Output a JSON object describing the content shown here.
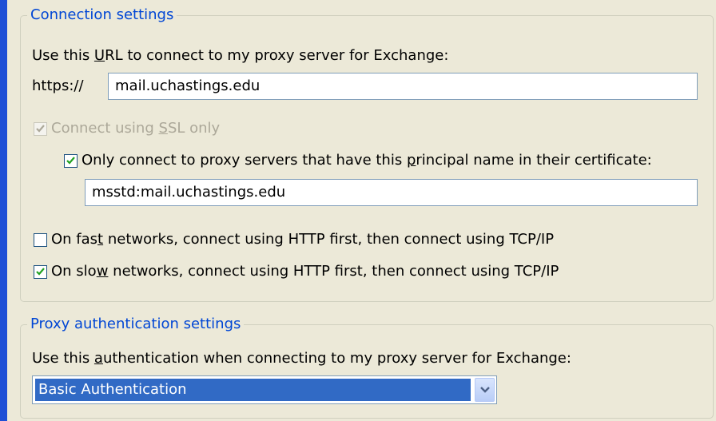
{
  "connection": {
    "group_title": "Connection settings",
    "url_label_pre": "Use this ",
    "url_label_key": "U",
    "url_label_post": "RL to connect to my proxy server for Exchange:",
    "protocol_prefix": "https://",
    "url_value": "mail.uchastings.edu",
    "ssl_only": {
      "pre": "Connect using ",
      "key": "S",
      "post": "SL only",
      "checked": true,
      "enabled": false
    },
    "principal_only": {
      "pre": "Only connect to proxy servers that have this ",
      "key": "p",
      "post": "rincipal name in their certificate:",
      "checked": true
    },
    "principal_value": "msstd:mail.uchastings.edu",
    "fast_networks": {
      "pre": "On fas",
      "key": "t",
      "post": " networks, connect using HTTP first, then connect using TCP/IP",
      "checked": false
    },
    "slow_networks": {
      "pre": "On slo",
      "key": "w",
      "post": " networks, connect using HTTP first, then connect using TCP/IP",
      "checked": true
    }
  },
  "proxy_auth": {
    "group_title": "Proxy authentication settings",
    "label_pre": "Use this ",
    "label_key": "a",
    "label_post": "uthentication when connecting to my proxy server for Exchange:",
    "selected": "Basic Authentication"
  },
  "colors": {
    "group_title": "#0046d5",
    "dialog_bg": "#ece9d8",
    "check_green": "#21a121",
    "selection": "#316ac5"
  },
  "icons": {
    "check": "checkmark-icon",
    "dropdown": "chevron-down-icon"
  }
}
